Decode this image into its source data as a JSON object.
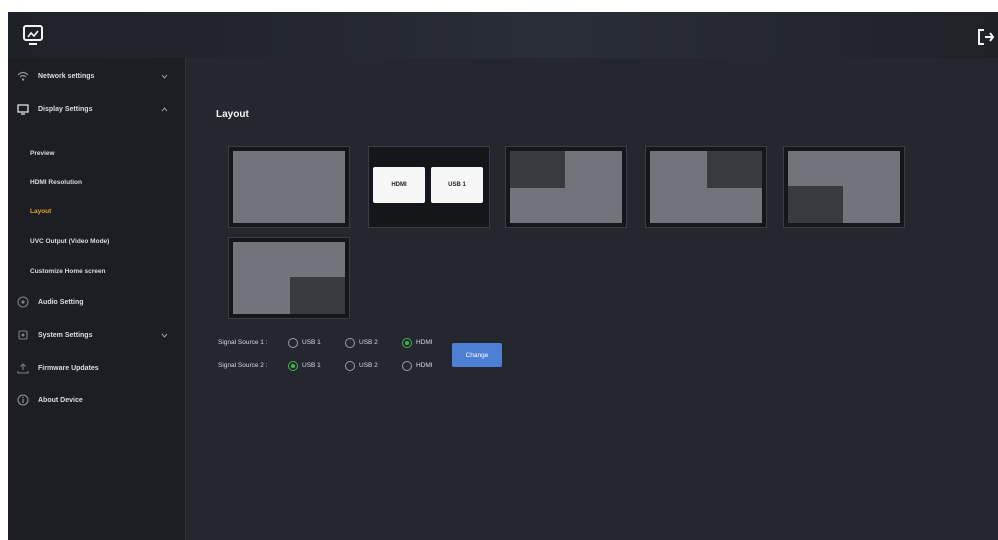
{
  "sidebar": {
    "items": [
      {
        "label": "Network settings",
        "icon": "wifi-icon"
      },
      {
        "label": "Display Settings",
        "icon": "monitor-icon"
      },
      {
        "label": "Audio Setting",
        "icon": "audio-icon"
      },
      {
        "label": "System Settings",
        "icon": "gear-icon"
      },
      {
        "label": "Firmware Updates",
        "icon": "upload-icon"
      },
      {
        "label": "About Device",
        "icon": "info-icon"
      }
    ],
    "display_sub": [
      {
        "label": "Preview"
      },
      {
        "label": "HDMI Resolution"
      },
      {
        "label": "Layout"
      },
      {
        "label": "UVC Output (Video Mode)"
      },
      {
        "label": "Customize Home screen"
      }
    ],
    "active_sub": "Layout"
  },
  "main": {
    "title": "Layout",
    "layouts": {
      "pip_labels": [
        "HDMI",
        "USB 1"
      ]
    },
    "signal_source_1": {
      "label": "Signal Source 1 :",
      "options": [
        "USB 1",
        "USB 2",
        "HDMI"
      ],
      "selected": "HDMI"
    },
    "signal_source_2": {
      "label": "Signal Source 2 :",
      "options": [
        "USB 1",
        "USB 2",
        "HDMI"
      ],
      "selected": "USB 1"
    },
    "change_label": "Change"
  },
  "colors": {
    "accent": "#4d7fd4",
    "selected_radio": "#3fb44d",
    "active_nav": "#d4a53a",
    "background": "#25272e"
  }
}
